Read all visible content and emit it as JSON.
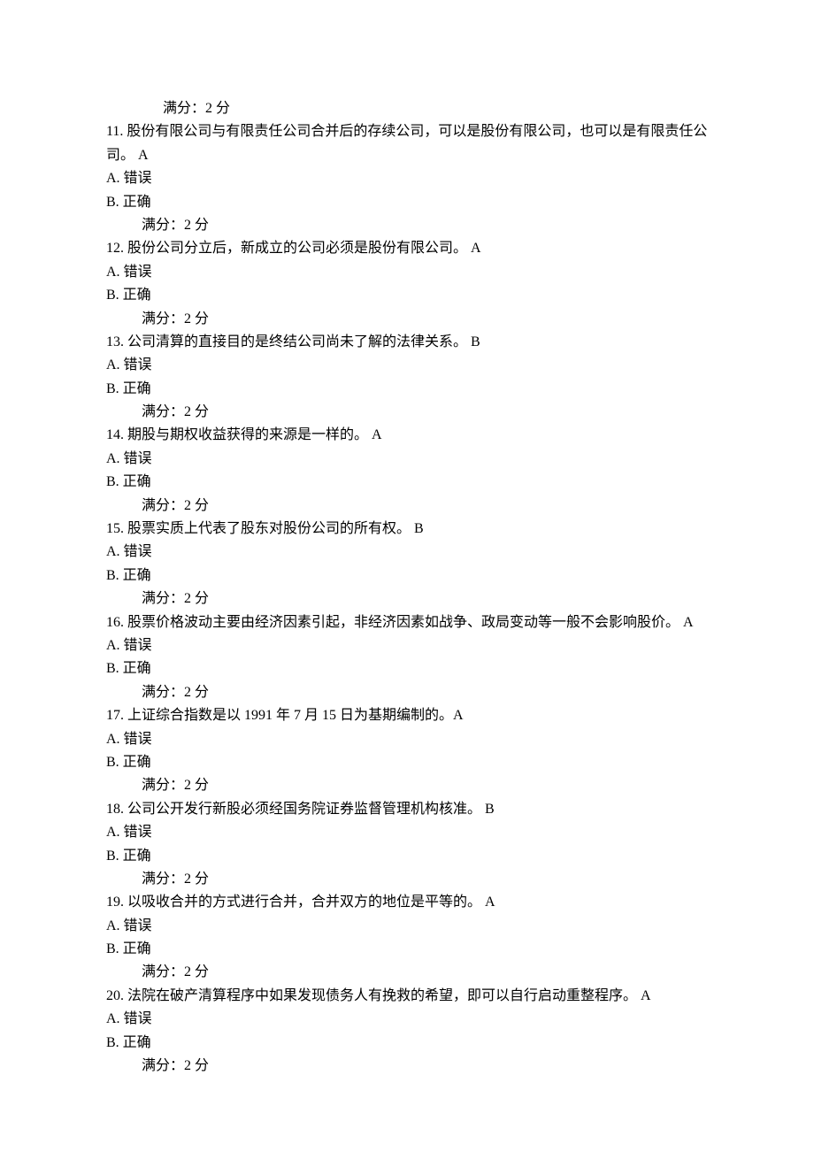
{
  "score_label_0": "满分：2   分",
  "questions": [
    {
      "number": "11.",
      "text": "  股份有限公司与有限责任公司合并后的存续公司，可以是股份有限公司，也可以是有限责任公司。 A",
      "options": [
        "A.  错误",
        "B.  正确"
      ],
      "score": "满分：2   分"
    },
    {
      "number": "12.",
      "text": "  股份公司分立后，新成立的公司必须是股份有限公司。 A",
      "options": [
        "A.  错误",
        "B.  正确"
      ],
      "score": "满分：2   分"
    },
    {
      "number": "13.",
      "text": "  公司清算的直接目的是终结公司尚未了解的法律关系。 B",
      "options": [
        "A.  错误",
        "B.  正确"
      ],
      "score": "满分：2   分"
    },
    {
      "number": "14.",
      "text": "  期股与期权收益获得的来源是一样的。 A",
      "options": [
        "A.  错误",
        "B.  正确"
      ],
      "score": "满分：2   分"
    },
    {
      "number": "15.",
      "text": "  股票实质上代表了股东对股份公司的所有权。 B",
      "options": [
        "A.  错误",
        "B.  正确"
      ],
      "score": "满分：2   分"
    },
    {
      "number": "16.",
      "text": "  股票价格波动主要由经济因素引起，非经济因素如战争、政局变动等一般不会影响股价。 A",
      "options": [
        "A.  错误",
        "B.  正确"
      ],
      "score": "满分：2   分"
    },
    {
      "number": "17.",
      "text": "  上证综合指数是以 1991 年 7 月 15 日为基期编制的。A",
      "options": [
        "A.  错误",
        "B.  正确"
      ],
      "score": "满分：2   分"
    },
    {
      "number": "18.",
      "text": "  公司公开发行新股必须经国务院证券监督管理机构核准。 B",
      "options": [
        "A.  错误",
        "B.  正确"
      ],
      "score": "满分：2   分"
    },
    {
      "number": "19.",
      "text": "  以吸收合并的方式进行合并，合并双方的地位是平等的。 A",
      "options": [
        "A.  错误",
        "B.  正确"
      ],
      "score": "满分：2   分"
    },
    {
      "number": "20.",
      "text": "  法院在破产清算程序中如果发现债务人有挽救的希望，即可以自行启动重整程序。 A",
      "options": [
        "A.  错误",
        "B.  正确"
      ],
      "score": "满分：2   分"
    }
  ]
}
